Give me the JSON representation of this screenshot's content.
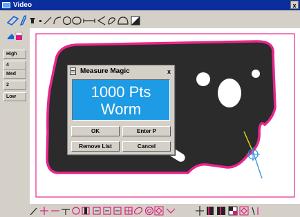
{
  "window": {
    "title": "Video",
    "close_label": "x"
  },
  "left_panel": {
    "buttons": [
      {
        "label": "High"
      },
      {
        "label": "4"
      },
      {
        "label": "Med"
      },
      {
        "label": "2"
      },
      {
        "label": "Low"
      }
    ]
  },
  "dialog": {
    "title": "Measure Magic",
    "close_label": "x",
    "display_line1": "1000 Pts",
    "display_line2": "Worm",
    "buttons": {
      "ok": "OK",
      "enter_p": "Enter P",
      "remove_list": "Remove List",
      "cancel": "Cancel"
    }
  },
  "colors": {
    "titlebar": "#0a2f9c",
    "tool_accent": "#e0177e",
    "tool_blue": "#1565d8",
    "part_fill": "#2b2b2b",
    "part_outline": "#e8268d",
    "display_bg": "#1e9be5",
    "measure_point": "#2f8fd8",
    "measure_line": "#f1d418"
  },
  "icons": {
    "top_toolbar": [
      "polygon-select-icon",
      "lasso-select-icon",
      "fill-icon",
      "point-icon",
      "line-icon",
      "arc-icon",
      "circle-icon",
      "slot-icon",
      "distance-icon",
      "angle-icon",
      "freeform-icon",
      "half-circle-icon",
      "contrast-icon"
    ],
    "bottom_toolbar": [
      "pen-icon",
      "cross-icon",
      "horizontal-line-icon",
      "tee-icon",
      "circle-gauge-icon",
      "rect-gauge-icon",
      "box-gauge-1-icon",
      "box-gauge-2-icon",
      "box-gauge-3-icon",
      "grid-icon",
      "ellipse-icon",
      "concentric-icon",
      "diamond-icon",
      "chevron-down-icon",
      "crosshair-icon",
      "bar-icon",
      "bars-icon",
      "pattern-icon",
      "diamond-box-icon",
      "edge-icon"
    ]
  }
}
